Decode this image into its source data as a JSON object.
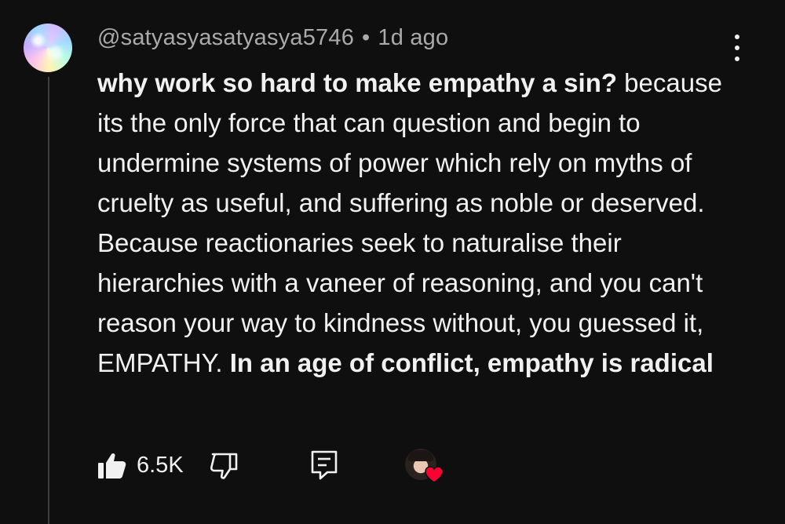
{
  "comment": {
    "author": "@satyasyasatyasya5746",
    "separator": "•",
    "timestamp": "1d ago",
    "text_bold_start": "why work so hard to make empathy a sin?",
    "text_body": " because its the only force that can question and begin to undermine systems of power which rely on myths of cruelty as useful, and suffering as noble or deserved. Because reactionaries seek to naturalise their hierarchies with a vaneer of reasoning, and you can't reason your way to kindness without, you guessed it, EMPATHY. ",
    "text_bold_end": "In an age of conflict, empathy is radical"
  },
  "actions": {
    "like_count": "6.5K",
    "like_icon": "thumbs-up-icon",
    "dislike_icon": "thumbs-down-icon",
    "reply_icon": "reply-comment-icon",
    "menu_icon": "more-vert-icon",
    "creator_heart_icon": "heart-icon"
  },
  "colors": {
    "background": "#0f0f0f",
    "primary_text": "#f1f1f1",
    "secondary_text": "#aaaaaa",
    "heart": "#ff0033"
  }
}
